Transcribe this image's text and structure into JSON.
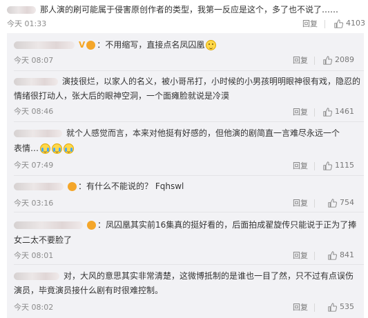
{
  "top_comment": {
    "text": "那人演的刷可能属于侵害原创作者的类型，我第一反应是这个，多了也不说了……",
    "time": "今天 01:33",
    "reply_label": "回复",
    "likes": "4103"
  },
  "replies": [
    {
      "text": "不用缩写，直接点名凤囚凰",
      "text_line2": "",
      "time": "今天 08:07",
      "reply_label": "回复",
      "likes": "2089"
    },
    {
      "text": "演技很烂，以家人的名义，被小哥吊打，小时候的小男孩明明眼神很有戏，隐忍的",
      "text_line2": "情绪很打动人，张大后的眼神空洞，一个面瘫脸就说是冷漠",
      "time": "今天 08:46",
      "reply_label": "回复",
      "likes": "1461"
    },
    {
      "text": "就个人感觉而言，本来对他挺有好感的，但他演的剧简直一言难尽永远一个",
      "text_line2": "表情…",
      "time": "今天 07:49",
      "reply_label": "回复",
      "likes": "1115"
    },
    {
      "text": "有什么不能说的？ Fqhswl",
      "text_line2": "",
      "time": "今天 03:16",
      "reply_label": "回复",
      "likes": "754"
    },
    {
      "text": "凤囚凰其实前16集真的挺好看的，后面拍成翟旋传只能说于正为了捧",
      "text_line2": "女二太不要脸了",
      "time": "今天 08:01",
      "reply_label": "回复",
      "likes": "841"
    },
    {
      "text": "对，大风的意思其实非常清楚，这微博抵制的是谁也一目了然，只不过有点误伤",
      "text_line2": "演员，毕竟演员接什么剧有时很难控制。",
      "time": "今天 08:02",
      "reply_label": "回复",
      "likes": "535"
    }
  ],
  "icons": {
    "like": "thumbs-up-icon",
    "badge": "weibo-user-badge-icon",
    "verified": "verified-v-icon",
    "emoji": "smile-emoji-icon",
    "cry": "laugh-cry-emoji-icon"
  },
  "colors": {
    "panel_bg": "#f2f2f5",
    "meta_text": "#8b8b8b",
    "badge_orange": "#f4a62a"
  }
}
